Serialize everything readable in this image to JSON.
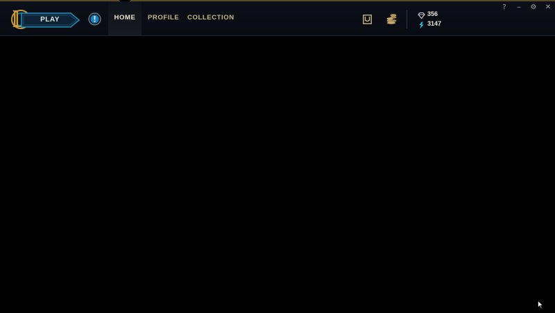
{
  "header": {
    "play_label": "PLAY"
  },
  "nav": {
    "tabs": [
      {
        "label": "HOME",
        "active": true
      },
      {
        "label": "PROFILE",
        "active": false
      },
      {
        "label": "COLLECTION",
        "active": false
      }
    ]
  },
  "icons": {
    "logo": "league-logo-icon",
    "alert": "exclamation-icon",
    "store": "store-icon",
    "loot": "loot-icon",
    "rp": "riot-points-icon",
    "be": "blue-essence-icon"
  },
  "currency": {
    "rp": "356",
    "be": "3147"
  },
  "window_controls": {
    "help": "?",
    "minimize": "–",
    "settings": "⚙",
    "close": "✕"
  },
  "colors": {
    "accent_gold": "#c8aa6e",
    "accent_blue": "#0ac8b9",
    "background": "#010101"
  }
}
